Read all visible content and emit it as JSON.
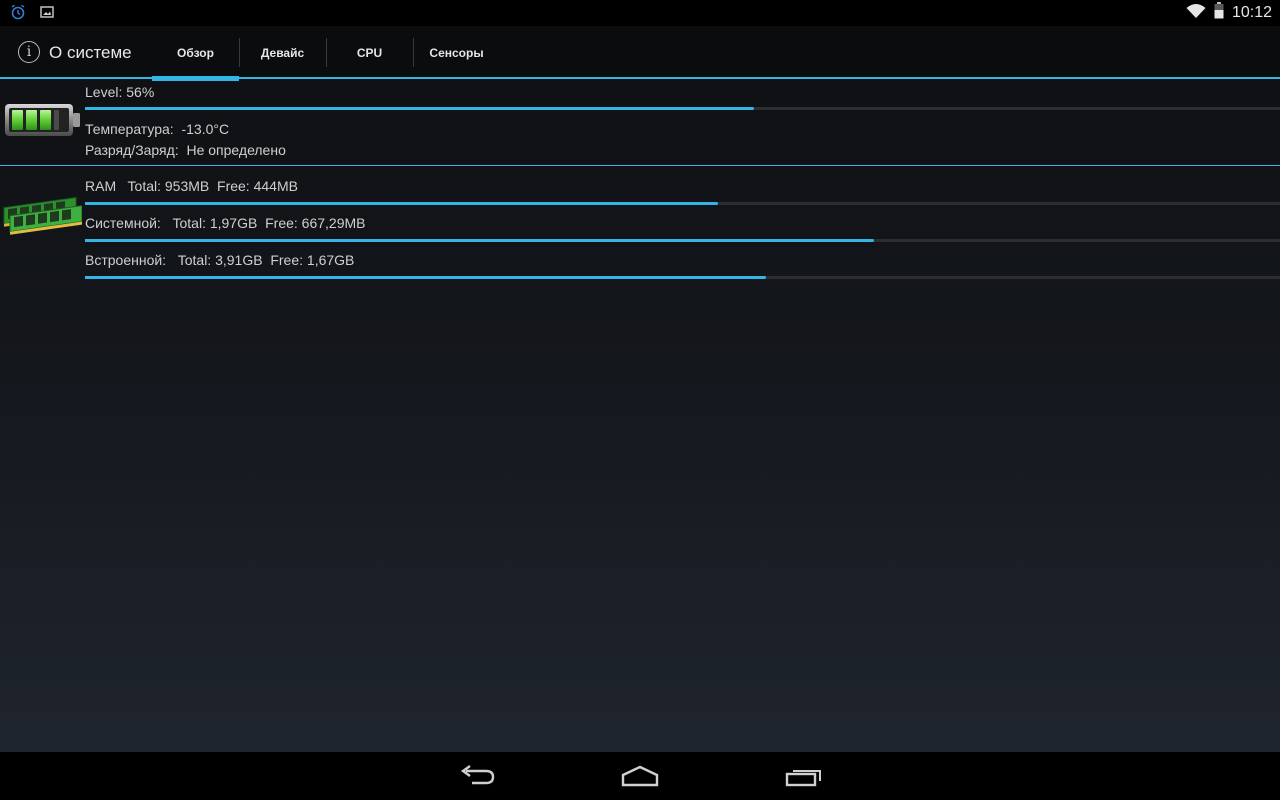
{
  "status_bar": {
    "left_icons": [
      "alarm-icon",
      "picture-notification-icon"
    ],
    "right_icons": [
      "wifi-icon",
      "battery-status-icon"
    ],
    "clock": "10:12"
  },
  "action_bar": {
    "icon": "info-icon",
    "icon_glyph": "i",
    "title": "О системе",
    "tabs": [
      {
        "label": "Обзор",
        "active": true
      },
      {
        "label": "Девайс",
        "active": false
      },
      {
        "label": "CPU",
        "active": false
      },
      {
        "label": "Сенсоры",
        "active": false
      }
    ]
  },
  "battery": {
    "icon": "battery-icon",
    "level_text": "Level: 56%",
    "level_percent": 56,
    "temperature_text": "Температура:  -13.0°C",
    "charge_text": "Разряд/Заряд:  Не определено"
  },
  "memory": {
    "icon": "ram-module-icon",
    "rows": [
      {
        "text": "RAM   Total: 953MB  Free: 444MB",
        "used_fraction": 0.53
      },
      {
        "text": "Системной:   Total: 1,97GB  Free: 667,29MB",
        "used_fraction": 0.66
      },
      {
        "text": "Встроенной:   Total: 3,91GB  Free: 1,67GB",
        "used_fraction": 0.57
      }
    ]
  },
  "nav_bar": {
    "buttons": [
      "back-icon",
      "home-icon",
      "recent-apps-icon"
    ]
  },
  "colors": {
    "accent": "#33b5e5",
    "battery_green": "#6ee04a",
    "ram_green": "#3aa83a"
  }
}
